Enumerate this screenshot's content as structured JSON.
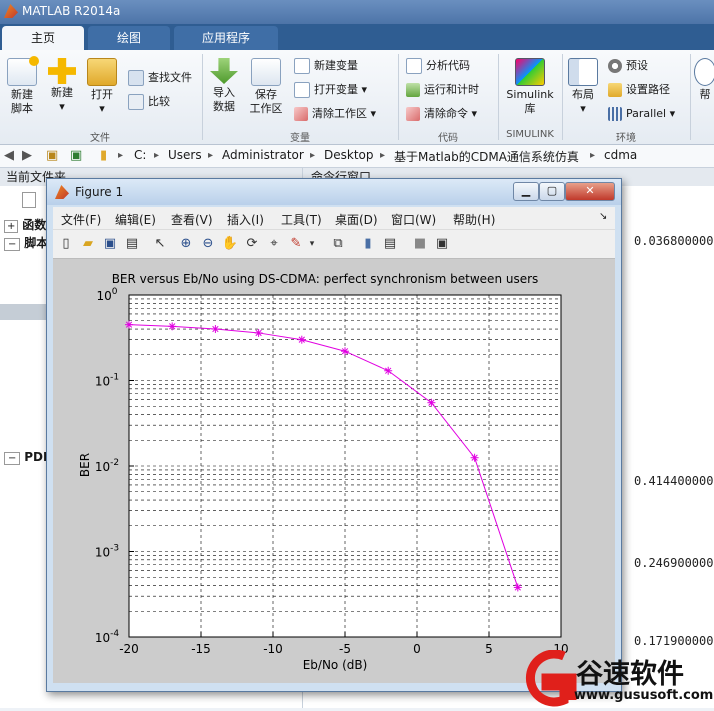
{
  "app": {
    "title": "MATLAB R2014a"
  },
  "tabs": [
    {
      "label": "主页"
    },
    {
      "label": "绘图"
    },
    {
      "label": "应用程序"
    }
  ],
  "ribbon": {
    "new_script": "新建\n脚本",
    "new": "新建",
    "open": "打开",
    "find_files": "查找文件",
    "compare": "比较",
    "group_file": "文件",
    "import_data": "导入\n数据",
    "save_workspace": "保存\n工作区",
    "new_variable": "新建变量",
    "open_variable": "打开变量",
    "clear_workspace": "清除工作区",
    "group_variable": "变量",
    "analyze_code": "分析代码",
    "run_and_time": "运行和计时",
    "clear_commands": "清除命令",
    "group_code": "代码",
    "simulink": "Simulink\n库",
    "group_simulink": "SIMULINK",
    "layout": "布局",
    "preferences": "预设",
    "set_path": "设置路径",
    "parallel": "Parallel",
    "group_env": "环境",
    "help": "帮"
  },
  "address": {
    "crumbs": [
      "C:",
      "Users",
      "Administrator",
      "Desktop",
      "基于Matlab的CDMA通信系统仿真",
      "cdma"
    ]
  },
  "left_panel": {
    "header": "当前文件夹",
    "items": [
      "函数",
      "脚本",
      "PDF"
    ]
  },
  "right_panel": {
    "header": "命令行窗口",
    "values": [
      "0.0368000000",
      "0.4144000000",
      "0.2469000000",
      "0.1719000000"
    ]
  },
  "figure": {
    "title": "Figure 1",
    "menu": [
      "文件(F)",
      "编辑(E)",
      "查看(V)",
      "插入(I)",
      "工具(T)",
      "桌面(D)",
      "窗口(W)",
      "帮助(H)"
    ]
  },
  "chart_data": {
    "type": "line",
    "title": "BER versus Eb/No using DS-CDMA: perfect synchronism between users",
    "xlabel": "Eb/No (dB)",
    "ylabel": "BER",
    "xlim": [
      -20,
      10
    ],
    "ylim": [
      0.0001,
      1
    ],
    "yscale": "log",
    "grid": true,
    "xticks": [
      -20,
      -15,
      -10,
      -5,
      0,
      5,
      10
    ],
    "yticks": [
      {
        "base": "10",
        "exp": "-4",
        "v": 0.0001
      },
      {
        "base": "10",
        "exp": "-3",
        "v": 0.001
      },
      {
        "base": "10",
        "exp": "-2",
        "v": 0.01
      },
      {
        "base": "10",
        "exp": "-1",
        "v": 0.1
      },
      {
        "base": "10",
        "exp": "0",
        "v": 1
      }
    ],
    "series": [
      {
        "color": "#e100e1",
        "marker": "asterisk",
        "x": [
          -20,
          -17,
          -14,
          -11,
          -8,
          -5,
          -2,
          1,
          4,
          7
        ],
        "y": [
          0.45,
          0.43,
          0.4,
          0.36,
          0.3,
          0.22,
          0.13,
          0.055,
          0.0125,
          0.00038
        ]
      }
    ]
  },
  "watermark": {
    "brand": "谷速软件",
    "url": "www.gususoft.com"
  }
}
